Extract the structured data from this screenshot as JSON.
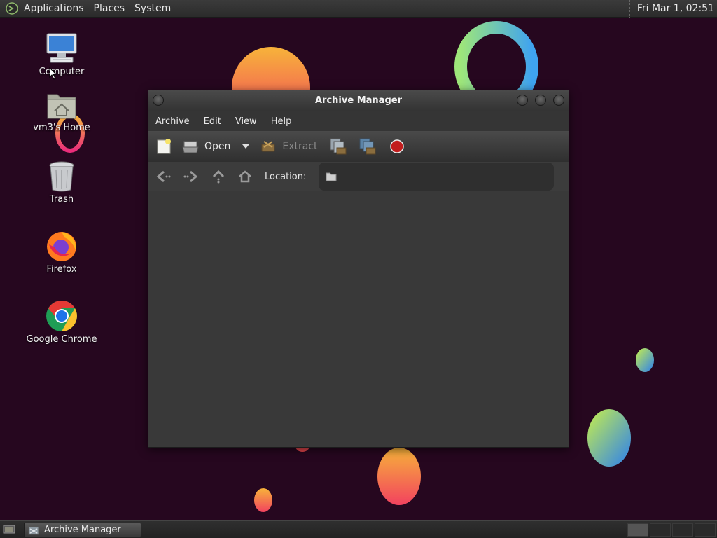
{
  "top_panel": {
    "menus": [
      "Applications",
      "Places",
      "System"
    ],
    "clock": "Fri Mar  1, 02:51"
  },
  "desktop_icons": [
    {
      "name": "computer",
      "label": "Computer",
      "icon": "computer-icon"
    },
    {
      "name": "home",
      "label": "vm3's Home",
      "icon": "home-folder-icon"
    },
    {
      "name": "trash",
      "label": "Trash",
      "icon": "trash-icon"
    },
    {
      "name": "firefox",
      "label": "Firefox",
      "icon": "firefox-icon"
    },
    {
      "name": "chrome",
      "label": "Google Chrome",
      "icon": "chrome-icon"
    }
  ],
  "window": {
    "title": "Archive Manager",
    "menubar": [
      "Archive",
      "Edit",
      "View",
      "Help"
    ],
    "toolbar": {
      "open_label": "Open",
      "extract_label": "Extract"
    },
    "location_label": "Location:"
  },
  "taskbar": {
    "task_label": "Archive Manager"
  },
  "colors": {
    "panel": "#2f2f2f",
    "window_bg": "#393939",
    "desktop_bg": "#26071f",
    "stop_red": "#c21d1d"
  }
}
